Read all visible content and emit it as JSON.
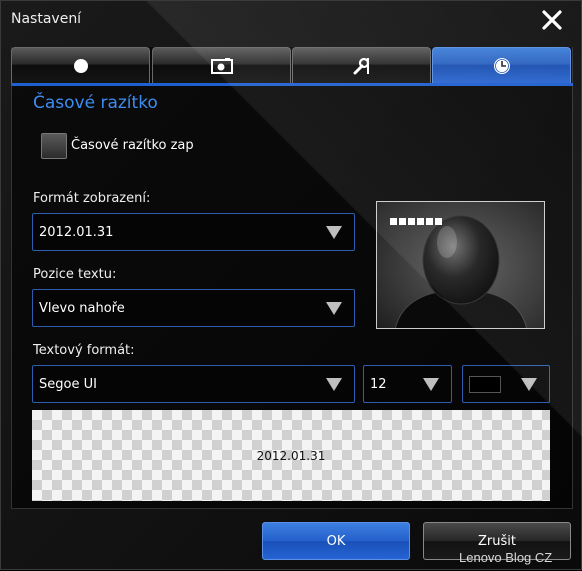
{
  "window": {
    "title": "Nastavení"
  },
  "tabs": [
    {
      "icon": "circle-icon",
      "active": false
    },
    {
      "icon": "camera-icon",
      "active": false
    },
    {
      "icon": "tools-icon",
      "active": false
    },
    {
      "icon": "clock-icon",
      "active": true
    }
  ],
  "section": {
    "title": "Časové razítko"
  },
  "timestamp_toggle": {
    "label": "Časové razítko zap",
    "checked": false
  },
  "display_format": {
    "label": "Formát zobrazení:",
    "value": "2012.01.31"
  },
  "text_position": {
    "label": "Pozice textu:",
    "value": "Vlevo nahoře"
  },
  "text_format": {
    "label": "Textový formát:",
    "font": "Segoe UI",
    "size": "12",
    "color": "#000000"
  },
  "preview": {
    "sample_text": "2012.01.31"
  },
  "buttons": {
    "ok": "OK",
    "cancel": "Zrušit"
  },
  "watermark": "Lenovo Blog CZ",
  "colors": {
    "accent": "#3e8df0",
    "tab_active": "#2c63c0",
    "select_border": "#2f5db0"
  }
}
